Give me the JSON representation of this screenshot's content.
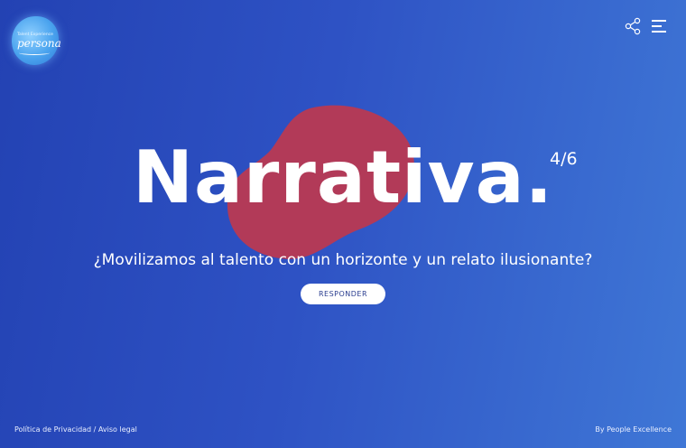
{
  "logo": {
    "small_text": "Talent Experience",
    "main_text": "persona"
  },
  "header": {
    "share_icon": "share-icon",
    "menu_icon": "hamburger-menu-icon"
  },
  "hero": {
    "title": "Narrativa.",
    "counter": "4/6",
    "subtitle": "¿Movilizamos al talento con un horizonte y un relato ilusionante?",
    "button_label": "RESPONDER",
    "blob_color": "#b23a58"
  },
  "footer": {
    "privacy_label": "Política de Privacidad",
    "separator": " / ",
    "legal_label": "Aviso legal",
    "credit": "By People Excellence"
  }
}
